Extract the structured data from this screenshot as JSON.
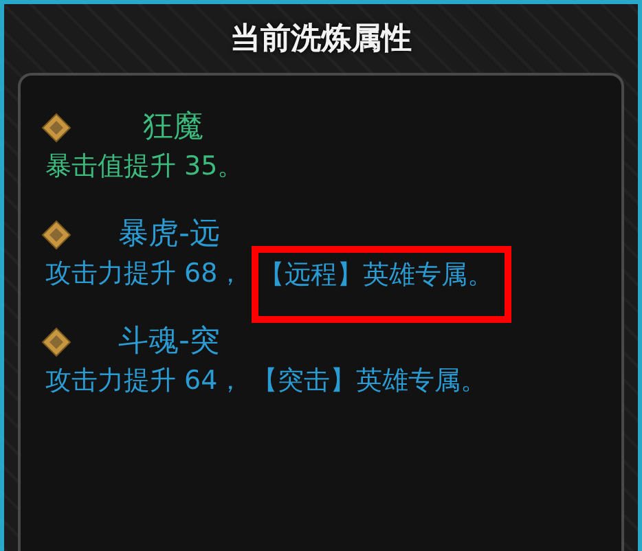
{
  "title": "当前洗炼属性",
  "stats": [
    {
      "name": "狂魔",
      "effect": "暴击值提升 35。",
      "color": "#3dbb7e"
    },
    {
      "name": "暴虎-远",
      "effect": "攻击力提升 68，",
      "restriction": "【远程】英雄专属。",
      "highlighted": true,
      "color": "#2b9bd3"
    },
    {
      "name": "斗魂-突",
      "effect": "攻击力提升 64，",
      "restriction": "【突击】英雄专属。",
      "highlighted": false,
      "color": "#2b9bd3"
    }
  ]
}
